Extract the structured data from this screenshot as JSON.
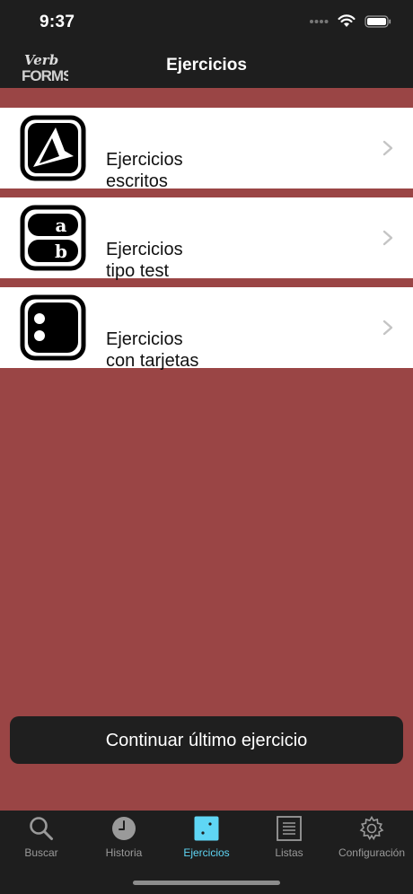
{
  "status": {
    "time": "9:37"
  },
  "nav": {
    "logo_top": "Verb",
    "logo_bottom": "FORMS",
    "title": "Ejercicios"
  },
  "rows": [
    {
      "line1": "Ejercicios",
      "line2": "escritos",
      "icon": "written-exercise-icon"
    },
    {
      "line1": "Ejercicios",
      "line2": "tipo test",
      "icon": "multiple-choice-icon"
    },
    {
      "line1": "Ejercicios",
      "line2": "con tarjetas",
      "icon": "flashcard-icon"
    }
  ],
  "continue_label": "Continuar último ejercicio",
  "tabs": [
    {
      "label": "Buscar",
      "icon": "search-icon",
      "active": false
    },
    {
      "label": "Historia",
      "icon": "clock-icon",
      "active": false
    },
    {
      "label": "Ejercicios",
      "icon": "dice-icon",
      "active": true
    },
    {
      "label": "Listas",
      "icon": "list-icon",
      "active": false
    },
    {
      "label": "Configuración",
      "icon": "gear-icon",
      "active": false
    }
  ],
  "colors": {
    "background": "#9a4545",
    "bars": "#1e1e1e",
    "accent": "#5fd6f5",
    "inactive_tab": "#9a9a9a"
  }
}
